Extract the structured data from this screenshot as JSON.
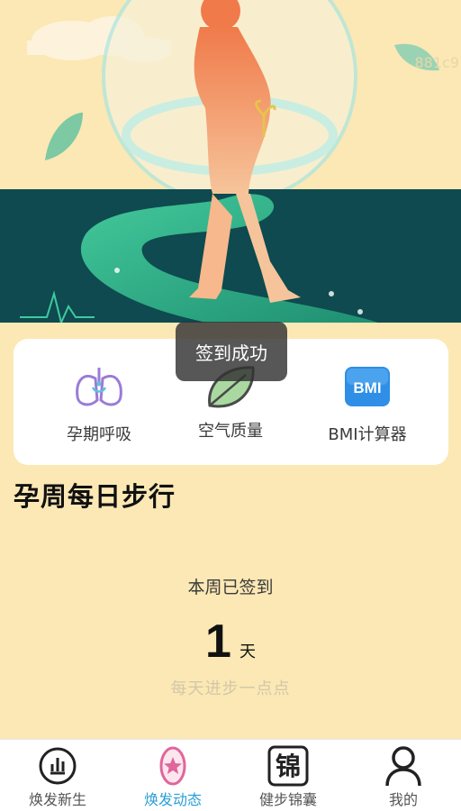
{
  "hero": {
    "code_text": "881c9"
  },
  "features": [
    {
      "label": "孕期呼吸",
      "icon": "lungs-icon"
    },
    {
      "label": "空气质量",
      "icon": "leaf-icon"
    },
    {
      "label": "BMI计算器",
      "icon": "bmi-icon",
      "icon_text": "BMI"
    }
  ],
  "section": {
    "title": "孕周每日步行"
  },
  "checkin": {
    "signed_label": "本周已签到",
    "days": "1",
    "unit": "天",
    "motto": "每天进步一点点"
  },
  "toast": {
    "message": "签到成功"
  },
  "nav": {
    "items": [
      {
        "label": "焕发新生",
        "icon": "chart-circle-icon",
        "active": false
      },
      {
        "label": "焕发动态",
        "icon": "star-badge-icon",
        "active": true
      },
      {
        "label": "健步锦囊",
        "icon": "jin-character-icon",
        "icon_text": "锦",
        "active": false
      },
      {
        "label": "我的",
        "icon": "person-icon",
        "active": false
      }
    ]
  },
  "colors": {
    "background": "#fbe8b4",
    "accent_blue": "#2a9fd6",
    "dark_teal": "#0e4a4f",
    "path_green": "#2fa784"
  }
}
